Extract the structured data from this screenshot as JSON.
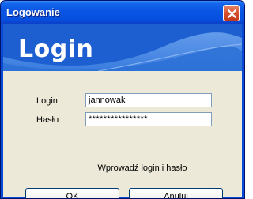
{
  "window": {
    "title": "Logowanie",
    "close_icon": "close-icon"
  },
  "banner": {
    "title": "Login"
  },
  "form": {
    "login_label": "Login",
    "login_value": "jannowak",
    "password_label": "Hasło",
    "password_value": "****************",
    "hint": "Wprowadź login i hasło"
  },
  "buttons": {
    "ok_label": "OK",
    "cancel_label": "Anuluj"
  },
  "colors": {
    "titlebar": "#0a55e3",
    "banner": "#2a6fd6",
    "dialog_background": "#ece9d8",
    "close_button": "#d6512f"
  }
}
